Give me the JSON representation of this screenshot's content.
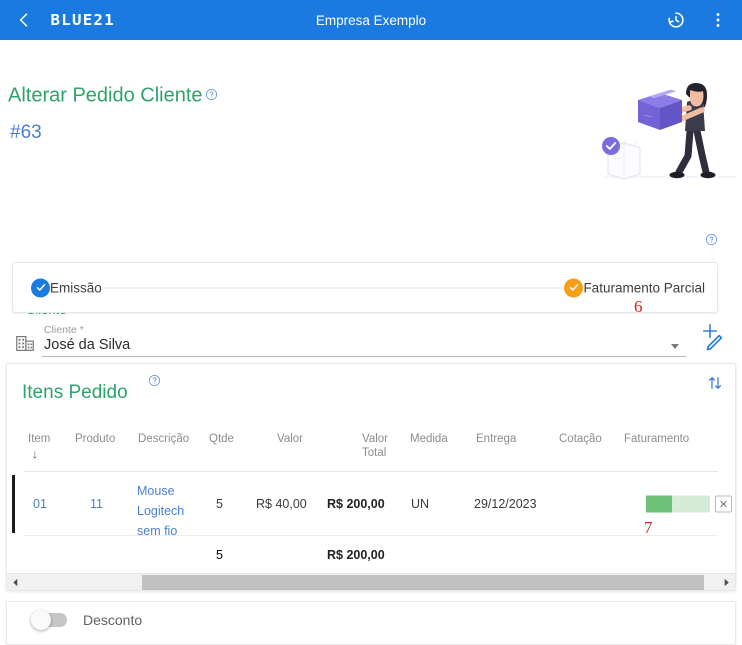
{
  "appbar": {
    "back_icon": "chevron-left-icon",
    "logo_text": "BLUE21",
    "title": "Empresa Exemplo",
    "history_icon": "history-icon",
    "menu_icon": "more-vert-icon"
  },
  "page": {
    "title": "Alterar Pedido Cliente",
    "order_number": "#63",
    "help_icon": "help-circle-icon",
    "illustration": "delivery-person-box-illustration"
  },
  "client": {
    "section_label": "Cliente",
    "field_caption": "Cliente *",
    "field_value": "José da Silva",
    "lead_icon": "building-icon",
    "caret_icon": "chevron-down-icon",
    "edit_icon": "pencil-icon"
  },
  "stepper": {
    "help_icon": "help-circle-icon",
    "add_icon": "plus-icon",
    "steps": [
      {
        "label": "Emissão",
        "state": "blue",
        "icon": "check-circle-icon"
      },
      {
        "label": "Faturamento Parcial",
        "state": "orange",
        "icon": "check-circle-icon"
      }
    ]
  },
  "annotations": [
    {
      "text": "6",
      "color": "#d32020"
    },
    {
      "text": "7",
      "color": "#d32020"
    }
  ],
  "items": {
    "title": "Itens Pedido",
    "help_icon": "help-circle-icon",
    "sort_icon": "sort-swap-icon",
    "sort_indicator": "↓",
    "columns": [
      "Item",
      "Produto",
      "Descrição",
      "Qtde",
      "Valor",
      "Valor\nTotal",
      "Medida",
      "Entrega",
      "Cotação",
      "Faturamento"
    ],
    "rows": [
      {
        "item": "01",
        "produto": "11",
        "descricao": "Mouse\nLogitech\nsem fio",
        "qtde": "5",
        "valor": "R$ 40,00",
        "valor_total": "R$ 200,00",
        "medida": "UN",
        "entrega": "29/12/2023",
        "cotacao": "",
        "faturamento_value": "2",
        "faturamento_percent": 40,
        "delete_icon": "close-box-icon"
      }
    ],
    "totals": {
      "qtde": "5",
      "valor_total": "R$ 200,00"
    }
  },
  "scrollbar": {
    "left_icon": "triangle-left-icon",
    "right_icon": "triangle-right-icon"
  },
  "discount": {
    "label": "Desconto",
    "enabled": false
  },
  "colors": {
    "appbar": "#1b7ae0",
    "green_heading": "#2ea36a",
    "blue_link": "#4a7fd0",
    "step_blue": "#1b7ae0",
    "step_orange": "#f5a014",
    "progress_fill": "#6ec177",
    "progress_track": "#d4ecd6",
    "annotation_red": "#d32020"
  }
}
